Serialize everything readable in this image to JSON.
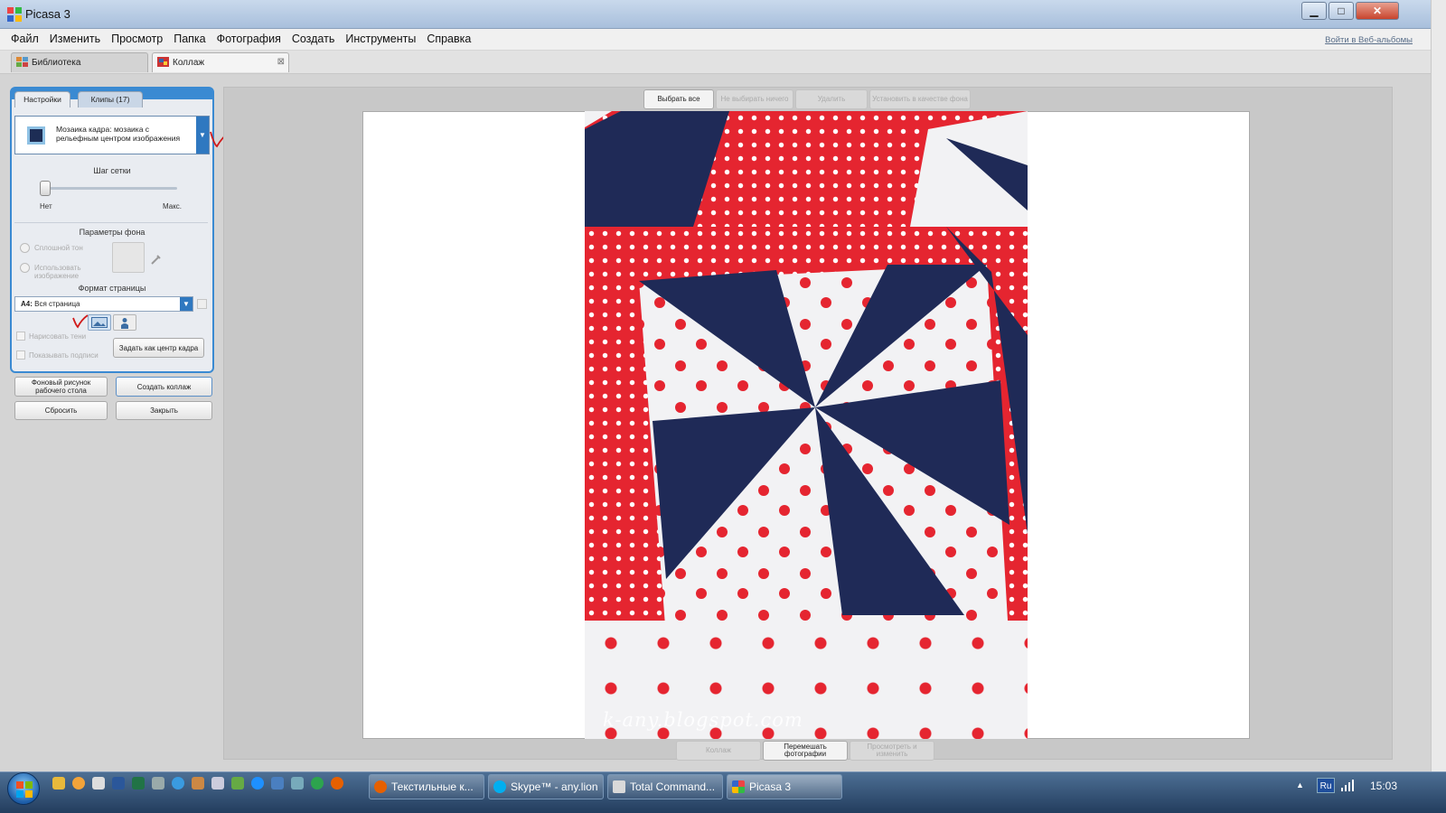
{
  "window": {
    "title": "Picasa 3",
    "minimize": "▁",
    "maximize": "□",
    "close": "✕"
  },
  "menu": {
    "items": [
      "Файл",
      "Изменить",
      "Просмотр",
      "Папка",
      "Фотография",
      "Создать",
      "Инструменты",
      "Справка"
    ],
    "login_link": "Войти в Веб-альбомы"
  },
  "doc_tabs": [
    {
      "label": "Библиотека",
      "icon": "library-grid-icon"
    },
    {
      "label": "Коллаж",
      "icon": "collage-icon",
      "close": "⊠"
    }
  ],
  "panel": {
    "tabs": [
      "Настройки",
      "Клипы (17)"
    ],
    "mode": {
      "text": "Мозаика кадра: мозаика с рельефным центром изображения",
      "icon": "mosaic-frame-icon",
      "arrow": "▼"
    },
    "grid": {
      "label": "Шаг сетки",
      "min_label": "Нет",
      "max_label": "Макс.",
      "value_fraction": 0.0
    },
    "background": {
      "title": "Параметры фона",
      "solid_label": "Сплошной тон",
      "image_label": "Использовать изображение",
      "eyedropper_icon": "eyedropper-icon"
    },
    "page_format": {
      "title": "Формат страницы",
      "value_bold": "A4:",
      "value": "Вся страница",
      "arrow": "▼",
      "orientation_landscape_icon": "landscape-orientation-icon",
      "orientation_portrait_icon": "portrait-orientation-icon"
    },
    "draw_shadows": "Нарисовать тени",
    "show_captions": "Показывать подписи",
    "set_center": "Задать как центр кадра",
    "buttons": {
      "wallpaper": "Фоновый рисунок рабочего стола",
      "create": "Создать коллаж",
      "reset": "Сбросить",
      "close": "Закрыть"
    }
  },
  "canvas_toolbar": [
    "Выбрать все",
    "Не выбирать ничего",
    "Удалить",
    "Установить в качестве фона"
  ],
  "bottom_toolbar": [
    "Коллаж",
    "Перемешать фотографии",
    "Просмотреть и изменить"
  ],
  "photo": {
    "watermark": "k-any.blogspot.com"
  },
  "annotations": {
    "checkmark": "✓",
    "color": "#d11a1a"
  },
  "taskbar": {
    "start_icon": "windows-start-orb-icon",
    "quicklaunch_icons": [
      "folder-icon",
      "chrome-like-icon",
      "calendar-icon",
      "word-icon",
      "excel-icon",
      "settings-icon",
      "browser-icon",
      "calc-icon",
      "doc-icon",
      "app-icon",
      "ie-icon",
      "window-icon",
      "network-icon",
      "green-app-icon",
      "firefox-icon"
    ],
    "tasks": [
      {
        "label": "Текстильные к...",
        "icon": "firefox-icon"
      },
      {
        "label": "Skype™ - any.lion",
        "icon": "skype-icon"
      },
      {
        "label": "Total Command...",
        "icon": "total-commander-icon"
      },
      {
        "label": "Picasa 3",
        "icon": "picasa-icon"
      }
    ],
    "tray_arrow": "▲",
    "language": "Ru",
    "signal_icon": "signal-bars-icon",
    "clock": "15:03"
  },
  "colors": {
    "accent": "#3a8ad2",
    "fabric_red": "#e52530",
    "fabric_navy": "#1f2a57"
  }
}
